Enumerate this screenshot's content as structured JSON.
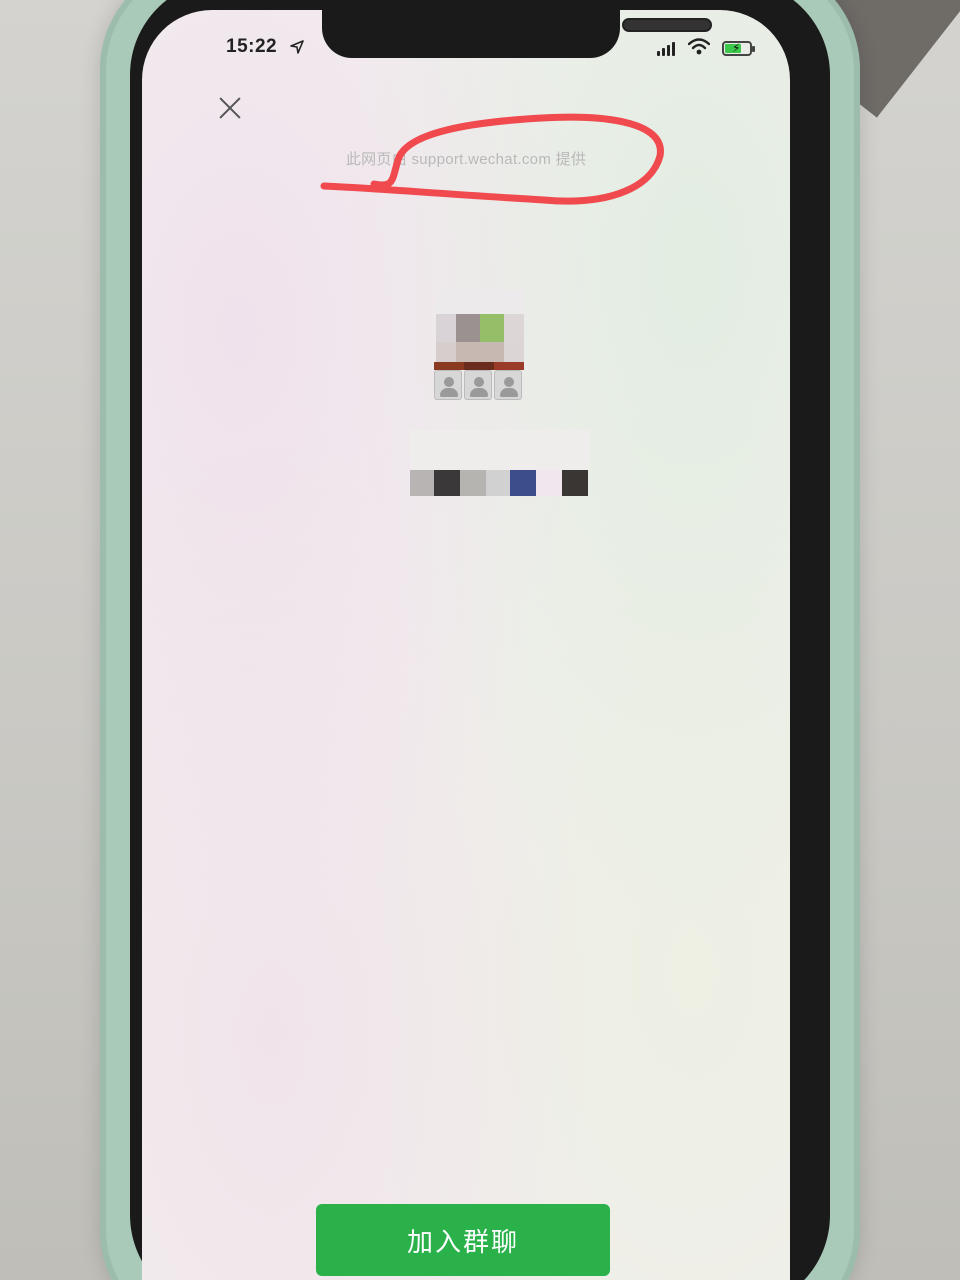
{
  "status_bar": {
    "time": "15:22"
  },
  "page": {
    "provider_note": "此网页由 support.wechat.com 提供",
    "join_button_label": "加入群聊"
  },
  "colors": {
    "accent": "#2ab14a",
    "annotation": "#f04a4e"
  },
  "icons": [
    "close-icon",
    "location-arrow-icon",
    "cellular-signal-icon",
    "wifi-icon",
    "battery-charging-icon",
    "default-member-avatar-icon"
  ]
}
